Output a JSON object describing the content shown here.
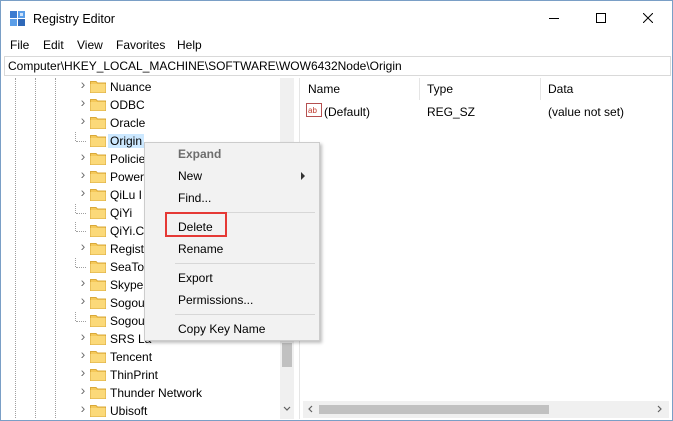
{
  "window": {
    "title": "Registry Editor",
    "minimize_icon": "minimize-icon",
    "maximize_icon": "maximize-icon",
    "close_icon": "close-icon"
  },
  "menubar": [
    "File",
    "Edit",
    "View",
    "Favorites",
    "Help"
  ],
  "address": "Computer\\HKEY_LOCAL_MACHINE\\SOFTWARE\\WOW6432Node\\Origin",
  "tree": {
    "items": [
      {
        "label": "Nuance",
        "expandable": true
      },
      {
        "label": "ODBC",
        "expandable": true
      },
      {
        "label": "Oracle",
        "expandable": true
      },
      {
        "label": "Origin",
        "expandable": false,
        "selected": true
      },
      {
        "label": "Policie",
        "expandable": true
      },
      {
        "label": "Power",
        "expandable": true
      },
      {
        "label": "QiLu I",
        "expandable": true
      },
      {
        "label": "QiYi",
        "expandable": false
      },
      {
        "label": "QiYi.C",
        "expandable": false
      },
      {
        "label": "Regist",
        "expandable": true
      },
      {
        "label": "SeaToo",
        "expandable": false
      },
      {
        "label": "Skype",
        "expandable": true
      },
      {
        "label": "Sogou",
        "expandable": true
      },
      {
        "label": "Sogou",
        "expandable": false
      },
      {
        "label": "SRS La",
        "expandable": true
      },
      {
        "label": "Tencent",
        "expandable": true
      },
      {
        "label": "ThinPrint",
        "expandable": true
      },
      {
        "label": "Thunder Network",
        "expandable": true
      },
      {
        "label": "Ubisoft",
        "expandable": true
      }
    ]
  },
  "list": {
    "columns": [
      "Name",
      "Type",
      "Data"
    ],
    "rows": [
      {
        "name": "(Default)",
        "type": "REG_SZ",
        "data": "(value not set)",
        "icon": "string-value-icon"
      }
    ]
  },
  "context_menu": {
    "header": "Expand",
    "items": [
      {
        "label": "New",
        "submenu": true
      },
      {
        "label": "Find..."
      },
      {
        "label": "Delete"
      },
      {
        "label": "Rename"
      },
      {
        "label": "Export"
      },
      {
        "label": "Permissions..."
      },
      {
        "label": "Copy Key Name"
      }
    ]
  },
  "colors": {
    "selection": "#cce8ff",
    "highlight_box": "#e53935",
    "folder": "#f5c95a"
  }
}
